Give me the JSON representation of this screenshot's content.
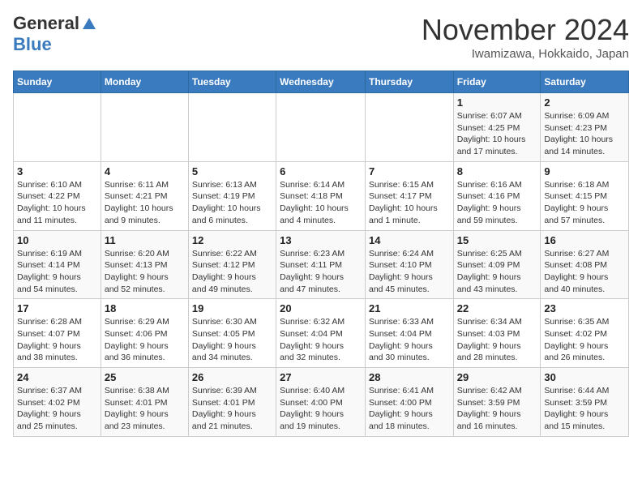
{
  "header": {
    "logo_general": "General",
    "logo_blue": "Blue",
    "month_title": "November 2024",
    "location": "Iwamizawa, Hokkaido, Japan"
  },
  "weekdays": [
    "Sunday",
    "Monday",
    "Tuesday",
    "Wednesday",
    "Thursday",
    "Friday",
    "Saturday"
  ],
  "weeks": [
    [
      {
        "day": "",
        "info": ""
      },
      {
        "day": "",
        "info": ""
      },
      {
        "day": "",
        "info": ""
      },
      {
        "day": "",
        "info": ""
      },
      {
        "day": "",
        "info": ""
      },
      {
        "day": "1",
        "info": "Sunrise: 6:07 AM\nSunset: 4:25 PM\nDaylight: 10 hours\nand 17 minutes."
      },
      {
        "day": "2",
        "info": "Sunrise: 6:09 AM\nSunset: 4:23 PM\nDaylight: 10 hours\nand 14 minutes."
      }
    ],
    [
      {
        "day": "3",
        "info": "Sunrise: 6:10 AM\nSunset: 4:22 PM\nDaylight: 10 hours\nand 11 minutes."
      },
      {
        "day": "4",
        "info": "Sunrise: 6:11 AM\nSunset: 4:21 PM\nDaylight: 10 hours\nand 9 minutes."
      },
      {
        "day": "5",
        "info": "Sunrise: 6:13 AM\nSunset: 4:19 PM\nDaylight: 10 hours\nand 6 minutes."
      },
      {
        "day": "6",
        "info": "Sunrise: 6:14 AM\nSunset: 4:18 PM\nDaylight: 10 hours\nand 4 minutes."
      },
      {
        "day": "7",
        "info": "Sunrise: 6:15 AM\nSunset: 4:17 PM\nDaylight: 10 hours\nand 1 minute."
      },
      {
        "day": "8",
        "info": "Sunrise: 6:16 AM\nSunset: 4:16 PM\nDaylight: 9 hours\nand 59 minutes."
      },
      {
        "day": "9",
        "info": "Sunrise: 6:18 AM\nSunset: 4:15 PM\nDaylight: 9 hours\nand 57 minutes."
      }
    ],
    [
      {
        "day": "10",
        "info": "Sunrise: 6:19 AM\nSunset: 4:14 PM\nDaylight: 9 hours\nand 54 minutes."
      },
      {
        "day": "11",
        "info": "Sunrise: 6:20 AM\nSunset: 4:13 PM\nDaylight: 9 hours\nand 52 minutes."
      },
      {
        "day": "12",
        "info": "Sunrise: 6:22 AM\nSunset: 4:12 PM\nDaylight: 9 hours\nand 49 minutes."
      },
      {
        "day": "13",
        "info": "Sunrise: 6:23 AM\nSunset: 4:11 PM\nDaylight: 9 hours\nand 47 minutes."
      },
      {
        "day": "14",
        "info": "Sunrise: 6:24 AM\nSunset: 4:10 PM\nDaylight: 9 hours\nand 45 minutes."
      },
      {
        "day": "15",
        "info": "Sunrise: 6:25 AM\nSunset: 4:09 PM\nDaylight: 9 hours\nand 43 minutes."
      },
      {
        "day": "16",
        "info": "Sunrise: 6:27 AM\nSunset: 4:08 PM\nDaylight: 9 hours\nand 40 minutes."
      }
    ],
    [
      {
        "day": "17",
        "info": "Sunrise: 6:28 AM\nSunset: 4:07 PM\nDaylight: 9 hours\nand 38 minutes."
      },
      {
        "day": "18",
        "info": "Sunrise: 6:29 AM\nSunset: 4:06 PM\nDaylight: 9 hours\nand 36 minutes."
      },
      {
        "day": "19",
        "info": "Sunrise: 6:30 AM\nSunset: 4:05 PM\nDaylight: 9 hours\nand 34 minutes."
      },
      {
        "day": "20",
        "info": "Sunrise: 6:32 AM\nSunset: 4:04 PM\nDaylight: 9 hours\nand 32 minutes."
      },
      {
        "day": "21",
        "info": "Sunrise: 6:33 AM\nSunset: 4:04 PM\nDaylight: 9 hours\nand 30 minutes."
      },
      {
        "day": "22",
        "info": "Sunrise: 6:34 AM\nSunset: 4:03 PM\nDaylight: 9 hours\nand 28 minutes."
      },
      {
        "day": "23",
        "info": "Sunrise: 6:35 AM\nSunset: 4:02 PM\nDaylight: 9 hours\nand 26 minutes."
      }
    ],
    [
      {
        "day": "24",
        "info": "Sunrise: 6:37 AM\nSunset: 4:02 PM\nDaylight: 9 hours\nand 25 minutes."
      },
      {
        "day": "25",
        "info": "Sunrise: 6:38 AM\nSunset: 4:01 PM\nDaylight: 9 hours\nand 23 minutes."
      },
      {
        "day": "26",
        "info": "Sunrise: 6:39 AM\nSunset: 4:01 PM\nDaylight: 9 hours\nand 21 minutes."
      },
      {
        "day": "27",
        "info": "Sunrise: 6:40 AM\nSunset: 4:00 PM\nDaylight: 9 hours\nand 19 minutes."
      },
      {
        "day": "28",
        "info": "Sunrise: 6:41 AM\nSunset: 4:00 PM\nDaylight: 9 hours\nand 18 minutes."
      },
      {
        "day": "29",
        "info": "Sunrise: 6:42 AM\nSunset: 3:59 PM\nDaylight: 9 hours\nand 16 minutes."
      },
      {
        "day": "30",
        "info": "Sunrise: 6:44 AM\nSunset: 3:59 PM\nDaylight: 9 hours\nand 15 minutes."
      }
    ]
  ]
}
